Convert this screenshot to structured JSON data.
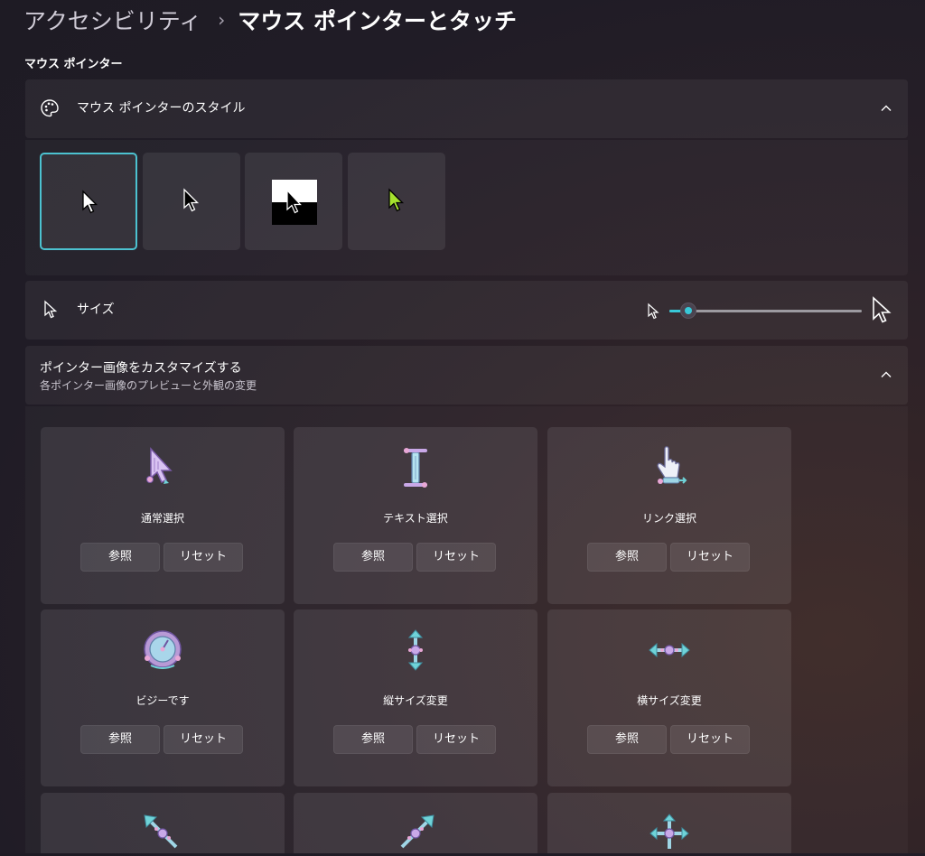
{
  "breadcrumb": {
    "parent": "アクセシビリティ",
    "separator": "›",
    "current": "マウス ポインターとタッチ"
  },
  "section_title": "マウス ポインター",
  "pointer_style": {
    "label": "マウス ポインターのスタイル",
    "options": [
      {
        "name": "白",
        "selected": true
      },
      {
        "name": "黒",
        "selected": false
      },
      {
        "name": "反転",
        "selected": false
      },
      {
        "name": "カスタム",
        "selected": false,
        "color": "#a6e22e"
      }
    ]
  },
  "size": {
    "label": "サイズ",
    "value_fraction": 0.1
  },
  "customize": {
    "title": "ポインター画像をカスタマイズする",
    "subtitle": "各ポインター画像のプレビューと外観の変更",
    "browse_label": "参照",
    "reset_label": "リセット",
    "tiles": [
      {
        "label": "通常選択",
        "icon": "arrow-pointer-icon"
      },
      {
        "label": "テキスト選択",
        "icon": "text-beam-icon"
      },
      {
        "label": "リンク選択",
        "icon": "hand-pointer-icon"
      },
      {
        "label": "ビジーです",
        "icon": "busy-clock-icon"
      },
      {
        "label": "縦サイズ変更",
        "icon": "vertical-resize-icon"
      },
      {
        "label": "横サイズ変更",
        "icon": "horizontal-resize-icon"
      },
      {
        "label": "",
        "icon": "diagonal-resize-1-icon"
      },
      {
        "label": "",
        "icon": "diagonal-resize-2-icon"
      },
      {
        "label": "",
        "icon": "move-icon"
      }
    ]
  },
  "colors": {
    "accent": "#38c8d8",
    "pointer_pastel": "#c9a8e8"
  }
}
